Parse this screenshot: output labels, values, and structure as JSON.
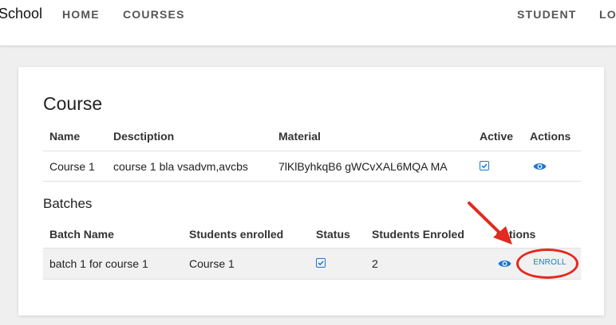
{
  "navbar": {
    "brand": "School",
    "links": [
      "HOME",
      "COURSES"
    ],
    "right_links": [
      "STUDENT",
      "LO"
    ]
  },
  "course": {
    "title": "Course",
    "headers": [
      "Name",
      "Desctiption",
      "Material",
      "Active",
      "Actions"
    ],
    "row": {
      "name": "Course 1",
      "description": "course 1 bla vsadvm,avcbs",
      "material": "7lKlByhkqB6 gWCvXAL6MQA MA",
      "active": true,
      "action_icon": "eye-icon"
    }
  },
  "batches": {
    "title": "Batches",
    "headers": [
      "Batch Name",
      "Students enrolled",
      "Status",
      "Students Enroled",
      "Actions"
    ],
    "row": {
      "batch_name": "batch 1 for course 1",
      "students_enrolled": "Course 1",
      "status": true,
      "students_enroled": "2",
      "action_icon": "eye-icon",
      "enroll_label": "ENROLL"
    }
  },
  "colors": {
    "accent": "#1976d2",
    "annotation": "#e4291e"
  }
}
